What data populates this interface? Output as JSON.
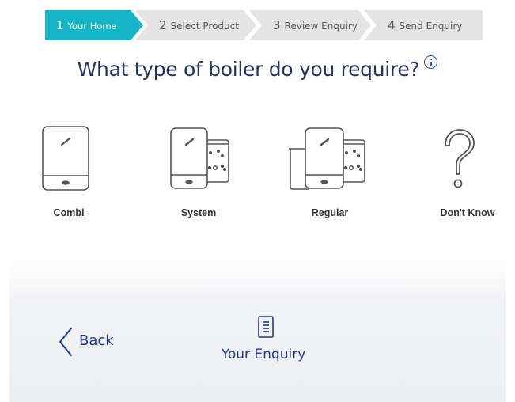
{
  "stepper": {
    "steps": [
      {
        "number": "1",
        "label": "Your Home",
        "active": true
      },
      {
        "number": "2",
        "label": "Select Product",
        "active": false
      },
      {
        "number": "3",
        "label": "Review Enquiry",
        "active": false
      },
      {
        "number": "4",
        "label": "Send Enquiry",
        "active": false
      }
    ]
  },
  "heading": {
    "title": "What type of boiler do you require?",
    "info_icon": "info-icon"
  },
  "options": [
    {
      "label": "Combi",
      "icon": "combi-boiler-icon"
    },
    {
      "label": "System",
      "icon": "system-boiler-icon"
    },
    {
      "label": "Regular",
      "icon": "regular-boiler-icon"
    },
    {
      "label": "Don't Know",
      "icon": "question-mark-icon"
    }
  ],
  "footer": {
    "back_label": "Back",
    "back_icon": "chevron-left-icon",
    "enquiry_label": "Your Enquiry",
    "enquiry_icon": "document-icon"
  },
  "colors": {
    "accent": "#14b5c7",
    "step_inactive": "#e4e4e4",
    "heading": "#24305e",
    "link": "#1e3a8a"
  }
}
